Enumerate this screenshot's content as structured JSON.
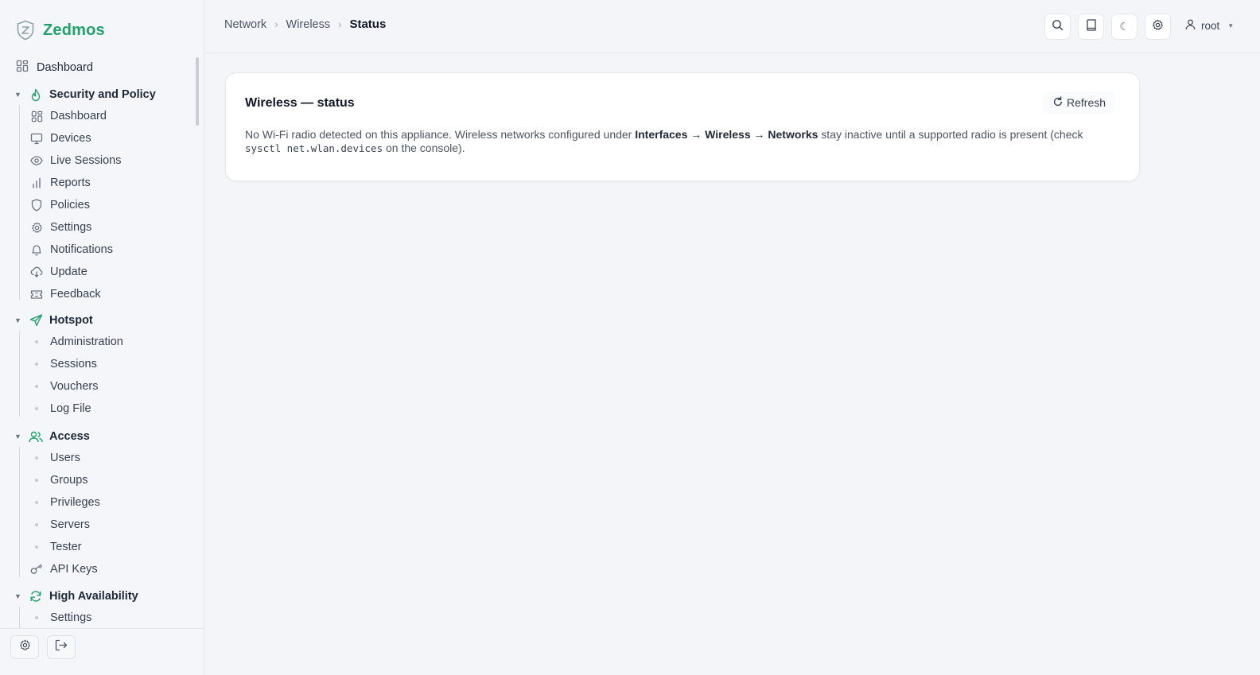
{
  "brand": {
    "name": "Zedmos"
  },
  "sidebar": {
    "top_item": {
      "label": "Dashboard",
      "icon": "dashboard-icon"
    },
    "groups": [
      {
        "label": "Security and Policy",
        "icon": "flame-icon",
        "items": [
          {
            "label": "Dashboard",
            "icon": "dashboard-icon"
          },
          {
            "label": "Devices",
            "icon": "monitor-icon"
          },
          {
            "label": "Live Sessions",
            "icon": "eye-icon"
          },
          {
            "label": "Reports",
            "icon": "bar-chart-icon"
          },
          {
            "label": "Policies",
            "icon": "shield-icon"
          },
          {
            "label": "Settings",
            "icon": "gear-icon"
          },
          {
            "label": "Notifications",
            "icon": "bell-icon"
          },
          {
            "label": "Update",
            "icon": "cloud-download-icon"
          },
          {
            "label": "Feedback",
            "icon": "ticket-icon"
          }
        ]
      },
      {
        "label": "Hotspot",
        "icon": "send-icon",
        "items": [
          {
            "label": "Administration",
            "icon": "dot"
          },
          {
            "label": "Sessions",
            "icon": "dot"
          },
          {
            "label": "Vouchers",
            "icon": "dot"
          },
          {
            "label": "Log File",
            "icon": "dot"
          }
        ]
      },
      {
        "label": "Access",
        "icon": "users-icon",
        "items": [
          {
            "label": "Users",
            "icon": "dot"
          },
          {
            "label": "Groups",
            "icon": "dot"
          },
          {
            "label": "Privileges",
            "icon": "dot"
          },
          {
            "label": "Servers",
            "icon": "dot"
          },
          {
            "label": "Tester",
            "icon": "dot"
          },
          {
            "label": "API Keys",
            "icon": "key-icon"
          }
        ]
      },
      {
        "label": "High Availability",
        "icon": "sync-icon",
        "items": [
          {
            "label": "Settings",
            "icon": "dot"
          }
        ]
      }
    ]
  },
  "breadcrumb": [
    "Network",
    "Wireless",
    "Status"
  ],
  "topbar": {
    "user": "root"
  },
  "card": {
    "title": "Wireless — status",
    "refresh_label": "Refresh",
    "text_1": "No Wi-Fi radio detected on this appliance. Wireless networks configured under ",
    "text_bold": "Interfaces → Wireless → Networks",
    "text_2": " stay inactive until a supported radio is present (check ",
    "text_code": "sysctl net.wlan.devices",
    "text_3": " on the console)."
  },
  "colors": {
    "accent": "#1fa36a",
    "background": "#f3f5f8",
    "card": "#ffffff"
  }
}
